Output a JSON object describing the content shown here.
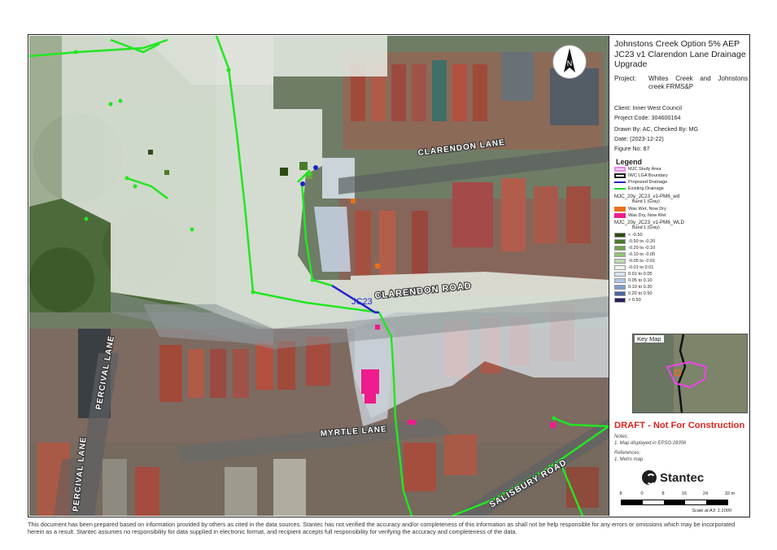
{
  "map": {
    "roads": {
      "clarendon_lane": "CLARENDON LANE",
      "clarendon_road": "CLARENDON ROAD",
      "percival_lane_1": "PERCIVAL LANE",
      "percival_lane_2": "PERCIVAL LANE",
      "myrtle_lane": "MYRTLE LANE",
      "salisbury_road": "SALISBURY ROAD"
    },
    "drainage_label": "JC23",
    "north_label": "N"
  },
  "panel": {
    "title": "Johnstons Creek Option 5% AEP JC23 v1 Clarendon Lane Drainage Upgrade",
    "project_key": "Project:",
    "project_value": "Whites Creek and Johnstons creek FRMS&P",
    "client": "Client:  Inner West Council",
    "project_code": "Project Code:  304600164",
    "drawn_by": "Drawn By: AC, Checked By: MG",
    "date": "Date:  (2023-12-22)",
    "figure_no": "Figure No:  87",
    "legend": {
      "title": "Legend",
      "items": [
        {
          "label": "MJC Study Area",
          "color": "#ee88ee",
          "kind": "outline"
        },
        {
          "label": "IWC LGA Boundary",
          "color": "#222222",
          "kind": "thick"
        },
        {
          "label": "Proposed Drainage",
          "color": "#2222cc",
          "kind": "line"
        },
        {
          "label": "Existing Drainage",
          "color": "#22dd22",
          "kind": "line"
        }
      ],
      "wd_header": "MJC_20y_JC23_v1-PM6_wd",
      "wd_sub": "Band 1 (Gray)",
      "wd_items": [
        {
          "label": "Was Wet, Now Dry",
          "color": "#e8701a"
        },
        {
          "label": "Was Dry, Now Wet",
          "color": "#ee1c8c"
        }
      ],
      "wld_header": "MJC_20y_JC23_v1-PM6_WLD",
      "wld_sub": "Band 1 (Gray)",
      "wld_items": [
        {
          "label": "< -0.50",
          "color": "#2d4a14"
        },
        {
          "label": "-0.50 to -0.20",
          "color": "#4a7a2a"
        },
        {
          "label": "-0.20 to -0.10",
          "color": "#6ea24c"
        },
        {
          "label": "-0.10 to -0.05",
          "color": "#94c27a"
        },
        {
          "label": "-0.05 to -0.01",
          "color": "#bcdcae"
        },
        {
          "label": "-0.01 to 0.01",
          "color": "#eef3ee"
        },
        {
          "label": "0.01 to 0.05",
          "color": "#d4e2f0"
        },
        {
          "label": "0.05 to 0.10",
          "color": "#b0c8e2"
        },
        {
          "label": "0.10 to 0.20",
          "color": "#7c9ccc"
        },
        {
          "label": "0.20 to 0.50",
          "color": "#4666a8"
        },
        {
          "label": "> 0.50",
          "color": "#2a1e5e"
        }
      ]
    },
    "key_map_label": "Key Map",
    "draft": "DRAFT - Not For Construction",
    "notes_title": "Notes:",
    "notes_1": "1. Map displayed in EPSG:28356",
    "references_title": "References:",
    "references_1": "1. Metro map",
    "logo": "Stantec",
    "scale": {
      "ticks": [
        "8",
        "0",
        "8",
        "16",
        "24",
        "32 m"
      ],
      "label": "Scale at A3: 1:1000"
    }
  },
  "footer": "This document has been prepared based on information provided by others as cited in the data sources. Stantec has not verified the accuracy and/or completeness of this information as shall not be help responsible for any errors or omissions which may be incorporated herein as a result. Stantec assumes no responsibility for data supplied in electronic format, and recipient accepts full responsibility for verifying the accuracy and completeness of the data."
}
